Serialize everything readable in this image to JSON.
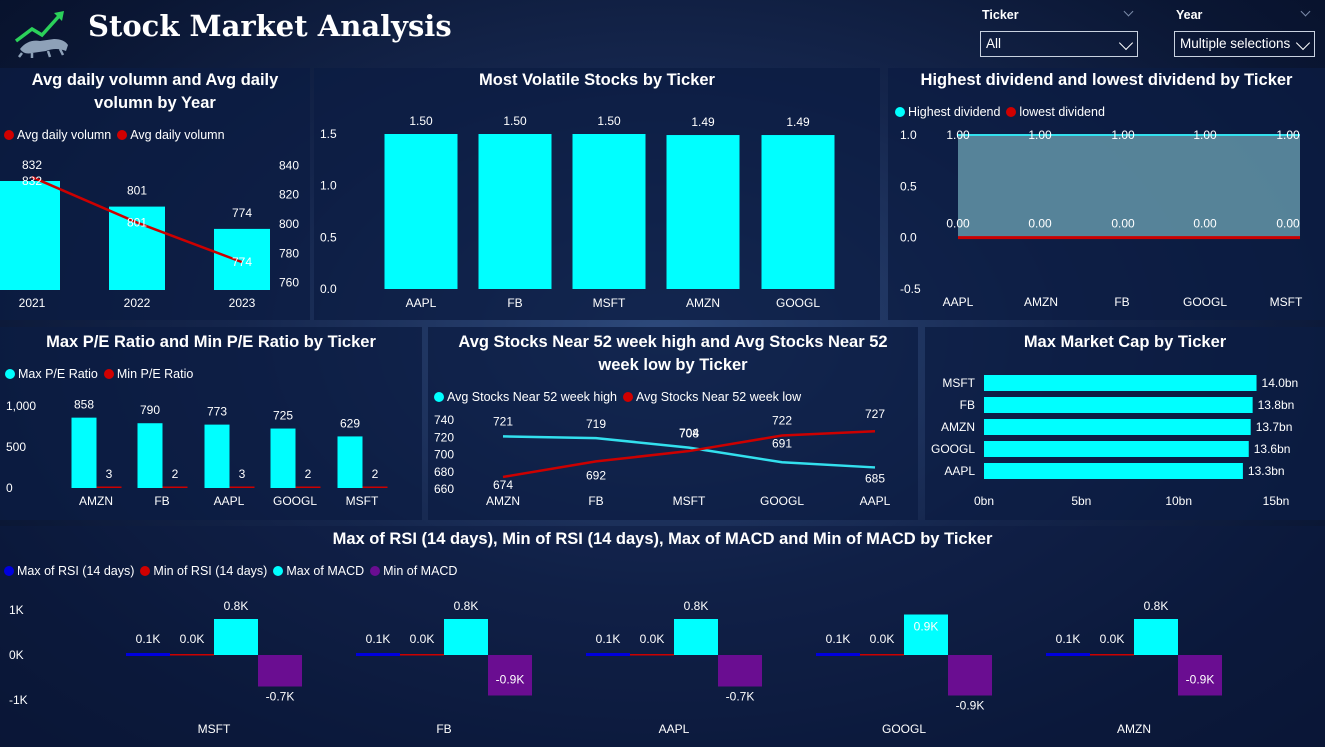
{
  "header": {
    "title": "Stock Market Analysis",
    "ticker_label": "Ticker",
    "ticker_value": "All",
    "year_label": "Year",
    "year_value": "Multiple selections"
  },
  "colors": {
    "cyan": "#00FFFF",
    "red": "#D00000",
    "blue": "#0000DD",
    "purple": "#6A0D91",
    "light_cyan_line": "#33E0EE"
  },
  "volume": {
    "title": "Avg daily volumn and Avg daily volumn by Year",
    "legend": [
      "Avg daily volumn",
      "Avg daily volumn"
    ]
  },
  "volatile": {
    "title": "Most Volatile Stocks by Ticker"
  },
  "dividend": {
    "title": "Highest dividend and lowest dividend by Ticker",
    "legend": [
      "Highest dividend",
      "lowest dividend"
    ]
  },
  "pe": {
    "title": "Max P/E Ratio and Min P/E Ratio by Ticker",
    "legend": [
      "Max P/E Ratio",
      "Min P/E Ratio"
    ]
  },
  "week52": {
    "title": "Avg Stocks Near 52 week high and Avg Stocks Near 52 week low by Ticker",
    "legend": [
      "Avg Stocks Near 52 week high",
      "Avg Stocks Near 52 week low"
    ]
  },
  "mcap": {
    "title": "Max Market Cap by Ticker"
  },
  "rsi": {
    "title": "Max of RSI (14 days), Min of RSI (14 days), Max of MACD and Min of MACD by Ticker",
    "legend": [
      "Max of RSI (14 days)",
      "Min of RSI (14 days)",
      "Max of MACD",
      "Min of MACD"
    ]
  },
  "chart_data": [
    {
      "id": "volume",
      "type": "bar",
      "title": "Avg daily volumn and Avg daily volumn by Year",
      "categories": [
        "2021",
        "2022",
        "2023"
      ],
      "series": [
        {
          "name": "Avg daily volumn",
          "kind": "bar",
          "values": [
            832,
            801,
            774
          ],
          "labels": [
            "832",
            "801",
            "774"
          ]
        },
        {
          "name": "Avg daily volumn",
          "kind": "line",
          "values": [
            832,
            801,
            774
          ],
          "labels": [
            "832",
            "801",
            "774"
          ]
        }
      ],
      "ylim": [
        755,
        845
      ],
      "yticks": [
        760,
        780,
        800,
        820,
        840
      ],
      "legend": "top-left"
    },
    {
      "id": "volatile",
      "type": "bar",
      "title": "Most Volatile Stocks by Ticker",
      "categories": [
        "AAPL",
        "FB",
        "MSFT",
        "AMZN",
        "GOOGL"
      ],
      "values": [
        1.5,
        1.5,
        1.5,
        1.49,
        1.49
      ],
      "labels": [
        "1.50",
        "1.50",
        "1.50",
        "1.49",
        "1.49"
      ],
      "ylim": [
        0,
        1.5
      ],
      "yticks": [
        "0.0",
        "0.5",
        "1.0",
        "1.5"
      ]
    },
    {
      "id": "dividend",
      "type": "area",
      "title": "Highest dividend and lowest dividend by Ticker",
      "categories": [
        "AAPL",
        "AMZN",
        "FB",
        "GOOGL",
        "MSFT"
      ],
      "series": [
        {
          "name": "Highest dividend",
          "values": [
            1,
            1,
            1,
            1,
            1
          ],
          "labels": [
            "1.00",
            "1.00",
            "1.00",
            "1.00",
            "1.00"
          ]
        },
        {
          "name": "lowest dividend",
          "values": [
            0,
            0,
            0,
            0,
            0
          ],
          "labels": [
            "0.00",
            "0.00",
            "0.00",
            "0.00",
            "0.00"
          ]
        }
      ],
      "ylim": [
        -0.5,
        1.0
      ],
      "yticks": [
        "-0.5",
        "0.0",
        "0.5",
        "1.0"
      ],
      "legend": "top-left"
    },
    {
      "id": "pe",
      "type": "bar",
      "title": "Max P/E Ratio and Min P/E Ratio by Ticker",
      "categories": [
        "AMZN",
        "FB",
        "AAPL",
        "GOOGL",
        "MSFT"
      ],
      "series": [
        {
          "name": "Max P/E Ratio",
          "values": [
            858,
            790,
            773,
            725,
            629
          ]
        },
        {
          "name": "Min P/E Ratio",
          "values": [
            3,
            2,
            3,
            2,
            2
          ]
        }
      ],
      "ylim": [
        0,
        1000
      ],
      "yticks": [
        "0",
        "500",
        "1,000"
      ]
    },
    {
      "id": "week52",
      "type": "line",
      "title": "Avg Stocks Near 52 week high and Avg Stocks Near 52 week low by Ticker",
      "categories": [
        "AMZN",
        "FB",
        "MSFT",
        "GOOGL",
        "AAPL"
      ],
      "series": [
        {
          "name": "Avg Stocks Near 52 week high",
          "values": [
            721,
            719,
            708,
            691,
            685
          ]
        },
        {
          "name": "Avg Stocks Near 52 week low",
          "values": [
            674,
            692,
            704,
            722,
            727
          ]
        }
      ],
      "ylim": [
        660,
        740
      ],
      "yticks": [
        "660",
        "680",
        "700",
        "720",
        "740"
      ]
    },
    {
      "id": "mcap",
      "type": "bar",
      "orientation": "horizontal",
      "title": "Max Market Cap by Ticker",
      "categories": [
        "MSFT",
        "FB",
        "AMZN",
        "GOOGL",
        "AAPL"
      ],
      "values": [
        14.0,
        13.8,
        13.7,
        13.6,
        13.3
      ],
      "labels": [
        "14.0bn",
        "13.8bn",
        "13.7bn",
        "13.6bn",
        "13.3bn"
      ],
      "xlim": [
        0,
        15
      ],
      "xticks": [
        "0bn",
        "5bn",
        "10bn",
        "15bn"
      ]
    },
    {
      "id": "rsi",
      "type": "bar",
      "title": "Max of RSI (14 days), Min of RSI (14 days), Max of MACD and Min of MACD by Ticker",
      "categories": [
        "MSFT",
        "FB",
        "AAPL",
        "GOOGL",
        "AMZN"
      ],
      "series": [
        {
          "name": "Max of RSI (14 days)",
          "values": [
            0.1,
            0.1,
            0.1,
            0.1,
            0.1
          ],
          "labels": [
            "0.1K",
            "0.1K",
            "0.1K",
            "0.1K",
            "0.1K"
          ]
        },
        {
          "name": "Min of RSI (14 days)",
          "values": [
            0.0,
            0.0,
            0.0,
            0.0,
            0.0
          ],
          "labels": [
            "0.0K",
            "0.0K",
            "0.0K",
            "0.0K",
            "0.0K"
          ]
        },
        {
          "name": "Max of MACD",
          "values": [
            0.8,
            0.8,
            0.8,
            0.9,
            0.8
          ],
          "labels": [
            "0.8K",
            "0.8K",
            "0.8K",
            "0.9K",
            "0.8K"
          ]
        },
        {
          "name": "Min of MACD",
          "values": [
            -0.7,
            -0.9,
            -0.7,
            -0.9,
            -0.9
          ],
          "labels": [
            "-0.7K",
            "-0.9K",
            "-0.7K",
            "-0.9K",
            "-0.9K"
          ]
        }
      ],
      "ylim": [
        -1,
        1
      ],
      "yticks": [
        "1K",
        "0K",
        "-1K"
      ]
    }
  ]
}
